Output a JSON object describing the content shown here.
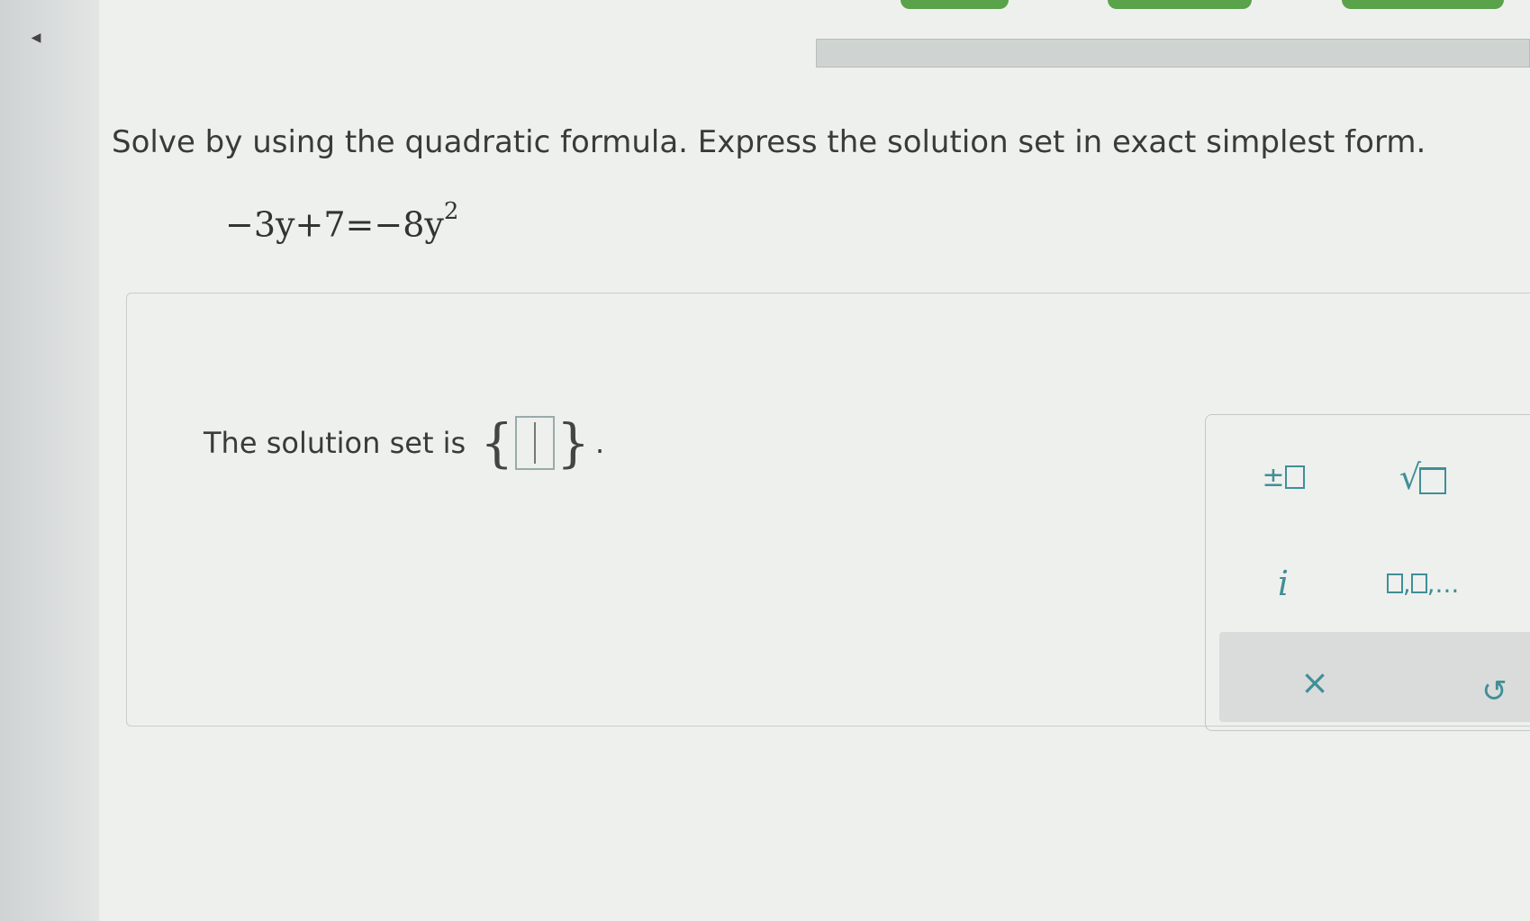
{
  "question": {
    "text": "Solve by using the quadratic formula. Express the solution set in exact simplest form."
  },
  "equation": {
    "left": "−3y+7",
    "equals": "=",
    "right": "−8y",
    "exponent": "2"
  },
  "answer": {
    "prefix": "The solution set is",
    "open_brace": "{",
    "close_brace": "}",
    "suffix": "."
  },
  "keypad": {
    "plus_minus": "±",
    "sqrt": "√",
    "imaginary": "i",
    "list_sep1": ",",
    "list_sep2": ",...",
    "clear": "×",
    "undo": "↺"
  },
  "nav": {
    "back_arrow": "◀"
  },
  "colors": {
    "accent": "#3f8f97",
    "progress_green": "#5aa34a"
  }
}
